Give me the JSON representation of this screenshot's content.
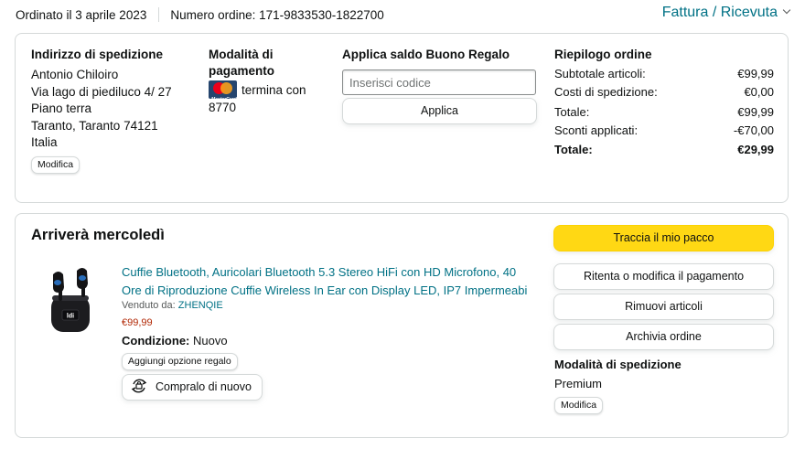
{
  "header": {
    "ordered_on": "Ordinato il 3 aprile 2023",
    "order_number": "Numero ordine: 171-9833530-1822700",
    "invoice_link": "Fattura / Ricevuta"
  },
  "shipping_address": {
    "title": "Indirizzo di spedizione",
    "lines": [
      "Antonio Chiloiro",
      "Via lago di piediluco 4/ 27",
      "Piano terra",
      "Taranto, Taranto 74121",
      "Italia"
    ],
    "edit_label": "Modifica"
  },
  "payment": {
    "title_line1": "Modalità di",
    "title_line2": "pagamento",
    "card_text": "termina con",
    "card_digits": "8770",
    "card_brand_mark": "MasterCard",
    "icon": "mastercard-icon"
  },
  "gift_card": {
    "title": "Applica saldo Buono Regalo",
    "placeholder": "Inserisci codice",
    "apply_label": "Applica"
  },
  "summary": {
    "title": "Riepilogo ordine",
    "rows": [
      {
        "label": "Subtotale articoli:",
        "value": "€99,99"
      },
      {
        "label": "Costi di spedizione:",
        "value": "€0,00"
      },
      {
        "label": "Totale:",
        "value": "€99,99"
      },
      {
        "label": "Sconti applicati:",
        "value": "-€70,00"
      },
      {
        "label": "Totale:",
        "value": "€29,99"
      }
    ]
  },
  "shipment": {
    "arrival": "Arriverà mercoledì",
    "product": {
      "title_line1": "Cuffie Bluetooth, Auricolari Bluetooth 5.3 Stereo HiFi con HD Microfono, 40",
      "title_line2": "Ore di Riproduzione Cuffie Wireless In Ear con Display LED, IP7 Impermeabi",
      "sold_by_label": "Venduto da:",
      "seller": "ZHENQIE",
      "price": "€99,99",
      "condition_label": "Condizione:",
      "condition_value": "Nuovo",
      "gift_option_label": "Aggiungi opzione regalo",
      "buy_again_label": "Compralo di nuovo",
      "display_text": "ldi"
    },
    "actions": {
      "track": "Traccia il mio pacco",
      "retry_payment": "Ritenta o modifica il pagamento",
      "remove_items": "Rimuovi articoli",
      "archive": "Archivia ordine"
    },
    "shipping_method": {
      "title": "Modalità di spedizione",
      "value": "Premium",
      "edit_label": "Modifica"
    }
  },
  "colors": {
    "link": "#007185",
    "price": "#b12704",
    "primary_button": "#ffd814",
    "border": "#d5d9d9"
  }
}
